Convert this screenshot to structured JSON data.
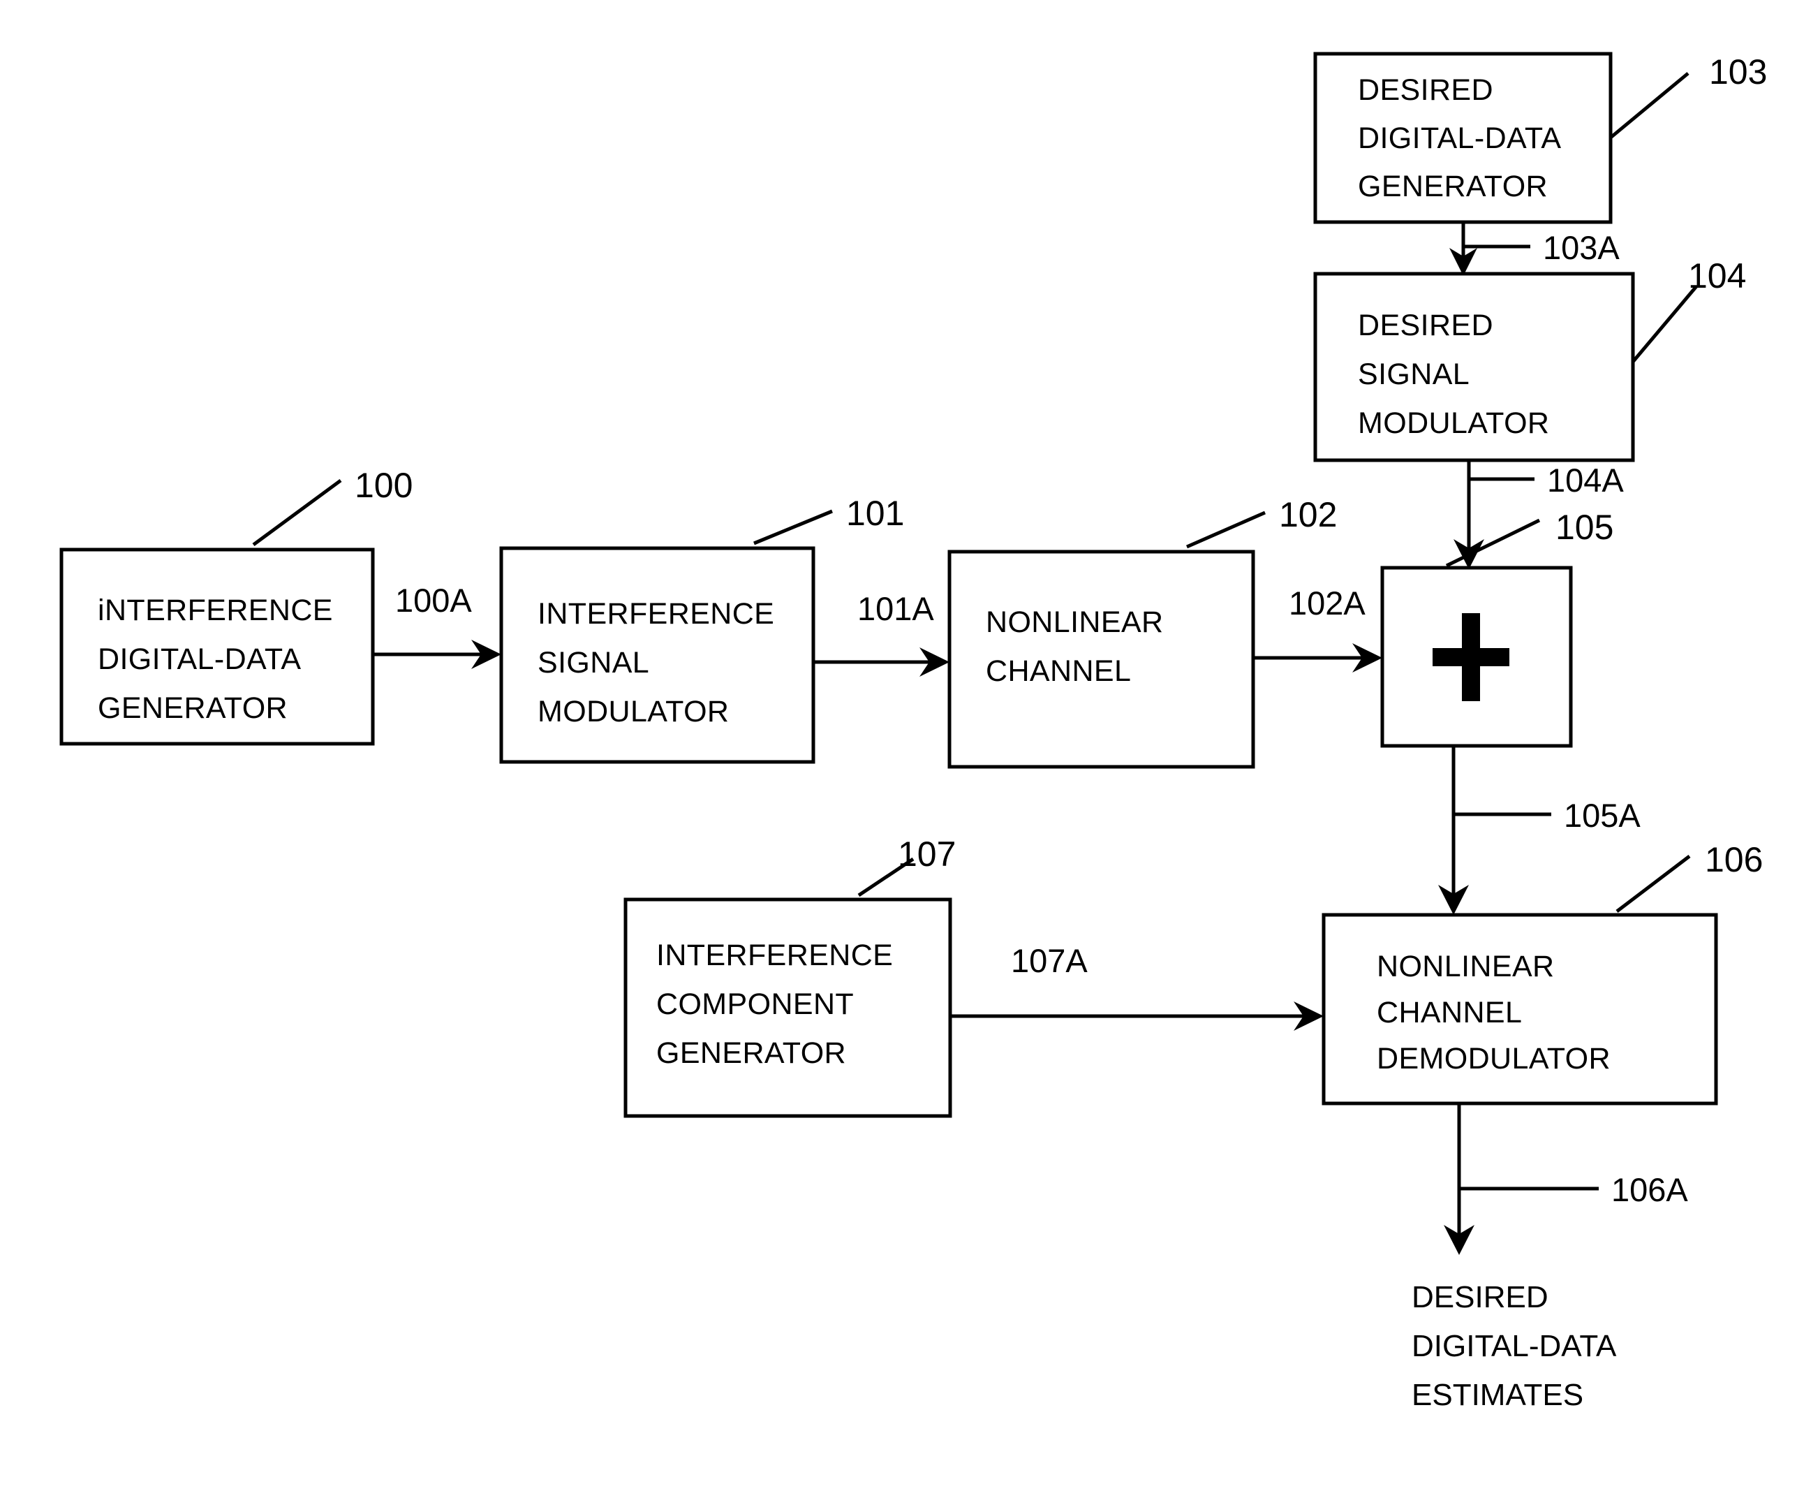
{
  "figure": {
    "type": "patent-block-diagram",
    "background_color": "#ffffff",
    "line_color": "#000000"
  },
  "blocks": [
    {
      "ref": "100",
      "name": "interference-digital-data-generator",
      "lines": [
        "iNTERFERENCE",
        "DIGITAL-DATA",
        "GENERATOR"
      ]
    },
    {
      "ref": "101",
      "name": "interference-signal-modulator",
      "lines": [
        "INTERFERENCE",
        "SIGNAL",
        "MODULATOR"
      ]
    },
    {
      "ref": "102",
      "name": "nonlinear-channel",
      "lines": [
        "NONLINEAR",
        "CHANNEL"
      ]
    },
    {
      "ref": "103",
      "name": "desired-digital-data-generator",
      "lines": [
        "DESIRED",
        "DIGITAL-DATA",
        "GENERATOR"
      ]
    },
    {
      "ref": "104",
      "name": "desired-signal-modulator",
      "lines": [
        "DESIRED",
        "SIGNAL",
        "MODULATOR"
      ]
    },
    {
      "ref": "105",
      "name": "summing-junction",
      "symbol": "+",
      "lines": []
    },
    {
      "ref": "106",
      "name": "nonlinear-channel-demodulator",
      "lines": [
        "NONLINEAR",
        "CHANNEL",
        "DEMODULATOR"
      ]
    },
    {
      "ref": "107",
      "name": "interference-component-generator",
      "lines": [
        "INTERFERENCE",
        "COMPONENT",
        "GENERATOR"
      ]
    }
  ],
  "signals": [
    {
      "ref": "100A",
      "from": "100",
      "to": "101"
    },
    {
      "ref": "101A",
      "from": "101",
      "to": "102"
    },
    {
      "ref": "102A",
      "from": "102",
      "to": "105"
    },
    {
      "ref": "103A",
      "from": "103",
      "to": "104"
    },
    {
      "ref": "104A",
      "from": "104",
      "to": "105"
    },
    {
      "ref": "105A",
      "from": "105",
      "to": "106"
    },
    {
      "ref": "106A",
      "from": "106",
      "to": "output"
    },
    {
      "ref": "107A",
      "from": "107",
      "to": "106"
    }
  ],
  "output": {
    "name": "desired-digital-data-estimates",
    "lines": [
      "DESIRED",
      "DIGITAL-DATA",
      "ESTIMATES"
    ]
  }
}
